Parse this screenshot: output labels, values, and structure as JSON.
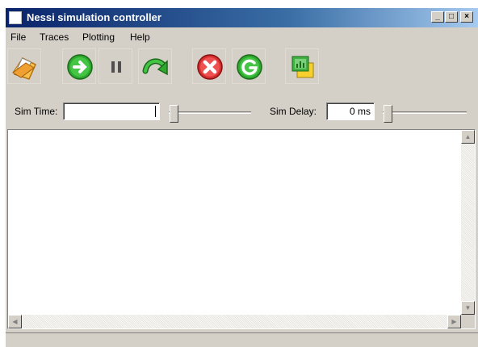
{
  "window": {
    "title": "Nessi simulation controller",
    "controls": {
      "minimize": "_",
      "maximize": "□",
      "close": "×"
    }
  },
  "menu": {
    "items": [
      "File",
      "Traces",
      "Plotting",
      "Help"
    ]
  },
  "toolbar": {
    "buttons": [
      {
        "icon": "open-folder-icon",
        "color": "#f0a030"
      },
      {
        "icon": "run-icon",
        "color": "#2ea82e"
      },
      {
        "icon": "pause-icon",
        "color": "#404040"
      },
      {
        "icon": "step-icon",
        "color": "#2ea82e"
      },
      {
        "icon": "stop-icon",
        "color": "#d43030"
      },
      {
        "icon": "reset-icon",
        "color": "#2ea82e"
      },
      {
        "icon": "plot-icon",
        "color": "#30a030"
      }
    ]
  },
  "controls": {
    "sim_time_label": "Sim Time:",
    "sim_time_value": "",
    "sim_delay_label": "Sim Delay:",
    "sim_delay_value": "0 ms"
  },
  "output": {
    "text": ""
  },
  "status": {
    "text": ""
  }
}
